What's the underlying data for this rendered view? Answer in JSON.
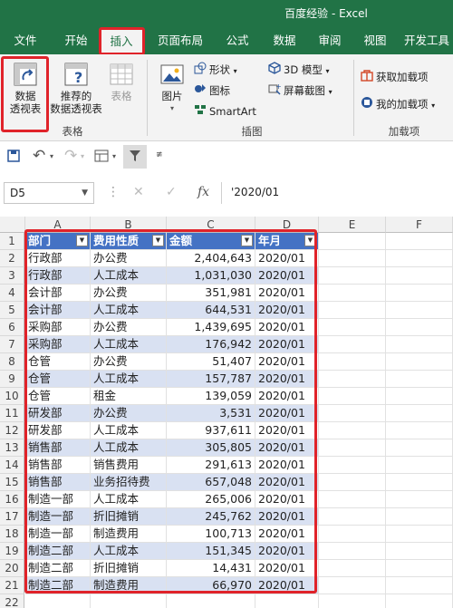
{
  "window": {
    "title": "百度经验  -  Excel"
  },
  "tabs": [
    {
      "label": "文件"
    },
    {
      "label": "开始"
    },
    {
      "label": "插入"
    },
    {
      "label": "页面布局"
    },
    {
      "label": "公式"
    },
    {
      "label": "数据"
    },
    {
      "label": "审阅"
    },
    {
      "label": "视图"
    },
    {
      "label": "开发工具"
    }
  ],
  "ribbon": {
    "tables_group": {
      "label": "表格",
      "pivot_table": "数据\n透视表",
      "recommended_pivot": "推荐的\n数据透视表",
      "table": "表格"
    },
    "illustrations_group": {
      "label": "插图",
      "pictures": "图片",
      "shapes": "形状",
      "icons": "图标",
      "smartart": "SmartArt",
      "model3d": "3D 模型",
      "screenshot": "屏幕截图"
    },
    "addins_group": {
      "label": "加载项",
      "get_addins": "获取加载项",
      "my_addins": "我的加载项"
    }
  },
  "formula_bar": {
    "name_box": "D5",
    "formula": "'2020/01",
    "fx": "fx"
  },
  "columns": [
    "A",
    "B",
    "C",
    "D",
    "E",
    "F"
  ],
  "table": {
    "headers": [
      "部门",
      "费用性质",
      "金额",
      "年月"
    ],
    "rows": [
      [
        "行政部",
        "办公费",
        "2,404,643",
        "2020/01"
      ],
      [
        "行政部",
        "人工成本",
        "1,031,030",
        "2020/01"
      ],
      [
        "会计部",
        "办公费",
        "351,981",
        "2020/01"
      ],
      [
        "会计部",
        "人工成本",
        "644,531",
        "2020/01"
      ],
      [
        "采购部",
        "办公费",
        "1,439,695",
        "2020/01"
      ],
      [
        "采购部",
        "人工成本",
        "176,942",
        "2020/01"
      ],
      [
        "仓管",
        "办公费",
        "51,407",
        "2020/01"
      ],
      [
        "仓管",
        "人工成本",
        "157,787",
        "2020/01"
      ],
      [
        "仓管",
        "租金",
        "139,059",
        "2020/01"
      ],
      [
        "研发部",
        "办公费",
        "3,531",
        "2020/01"
      ],
      [
        "研发部",
        "人工成本",
        "937,611",
        "2020/01"
      ],
      [
        "销售部",
        "人工成本",
        "305,805",
        "2020/01"
      ],
      [
        "销售部",
        "销售费用",
        "291,613",
        "2020/01"
      ],
      [
        "销售部",
        "业务招待费",
        "657,048",
        "2020/01"
      ],
      [
        "制造一部",
        "人工成本",
        "265,006",
        "2020/01"
      ],
      [
        "制造一部",
        "折旧摊销",
        "245,762",
        "2020/01"
      ],
      [
        "制造一部",
        "制造费用",
        "100,713",
        "2020/01"
      ],
      [
        "制造二部",
        "人工成本",
        "151,345",
        "2020/01"
      ],
      [
        "制造二部",
        "折旧摊销",
        "14,431",
        "2020/01"
      ],
      [
        "制造二部",
        "制造费用",
        "66,970",
        "2020/01"
      ]
    ]
  },
  "row_numbers": [
    "1",
    "2",
    "3",
    "4",
    "5",
    "6",
    "7",
    "8",
    "9",
    "10",
    "11",
    "12",
    "13",
    "14",
    "15",
    "16",
    "17",
    "18",
    "19",
    "20",
    "21",
    "22"
  ],
  "colors": {
    "excel_green": "#217346",
    "table_header": "#4472c4",
    "band": "#d9e1f2",
    "highlight_red": "#e0232a"
  }
}
